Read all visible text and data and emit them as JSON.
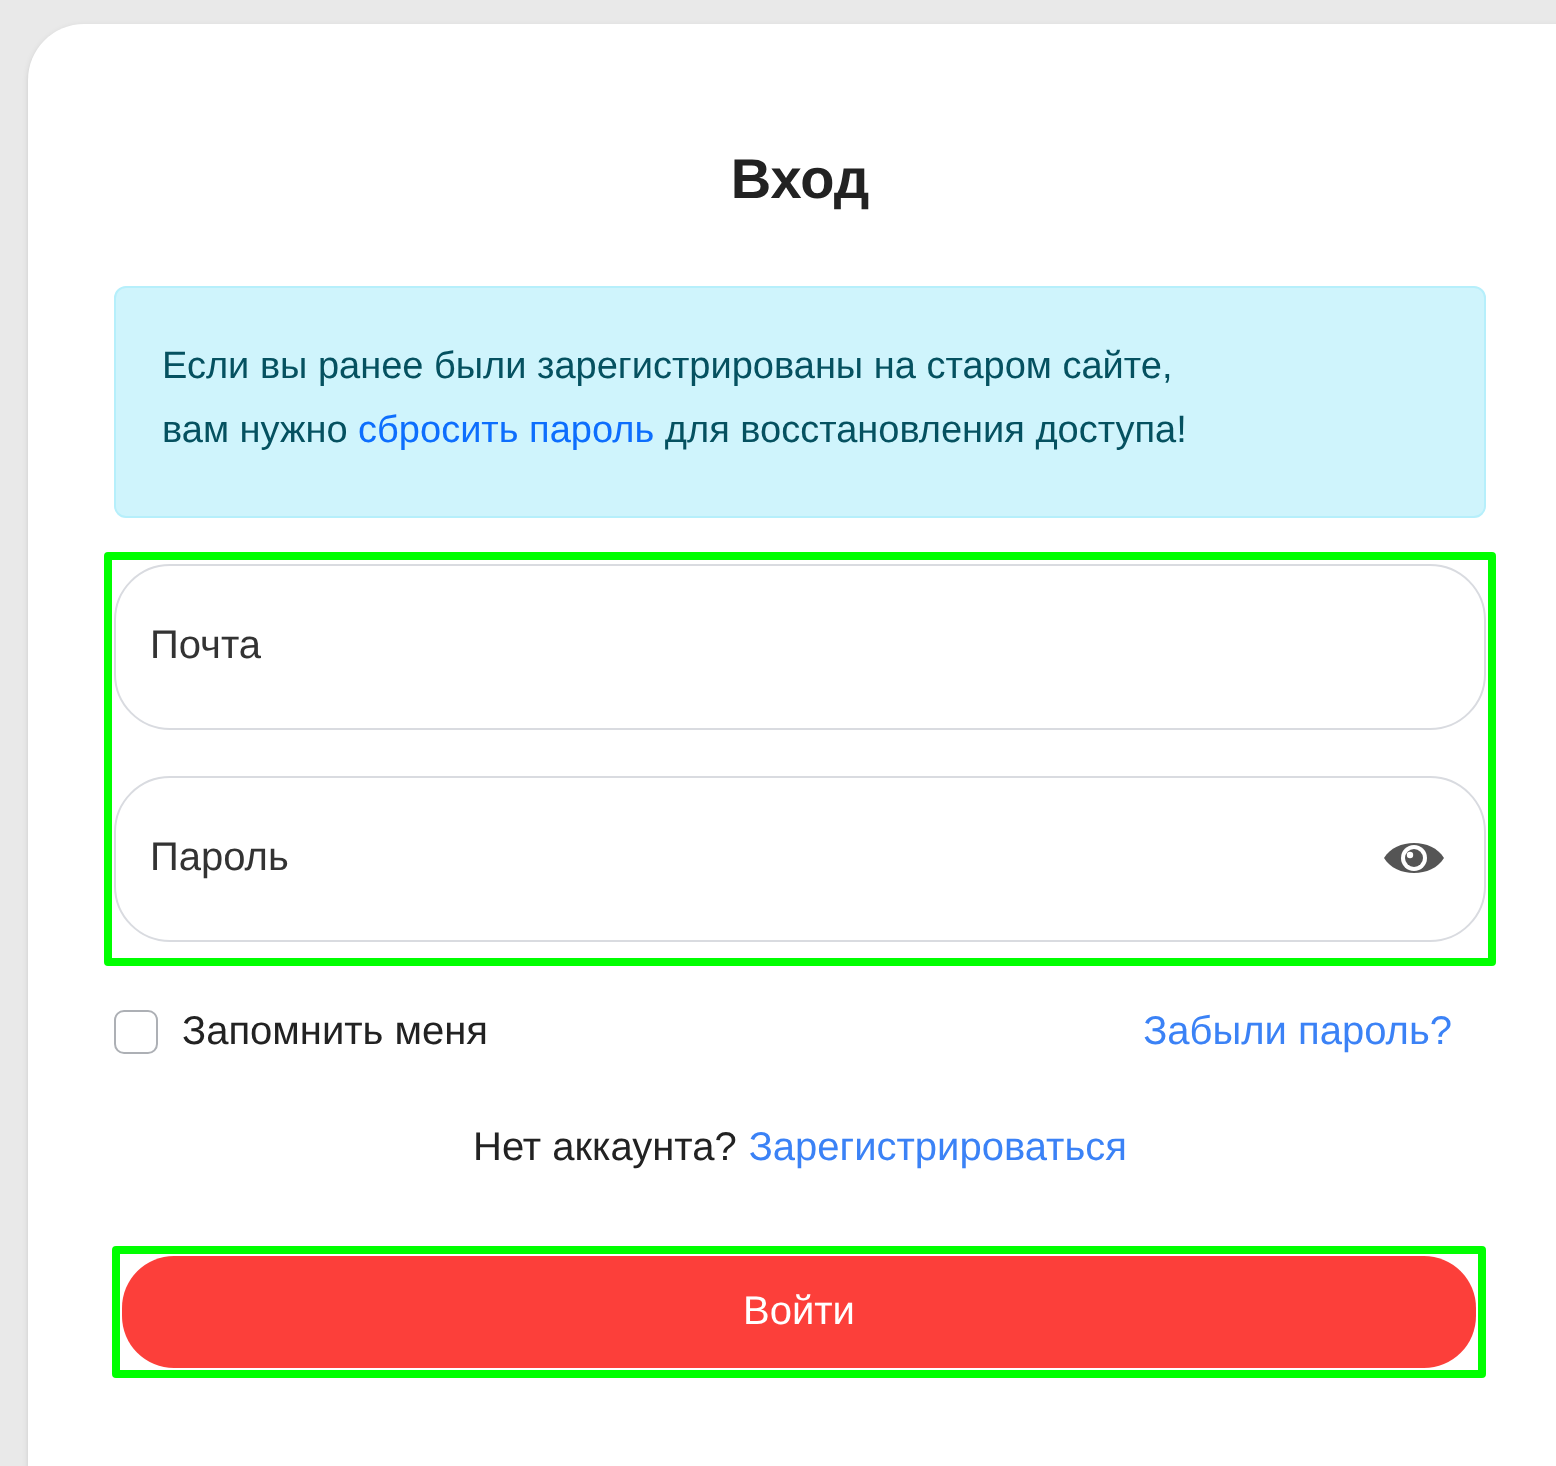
{
  "title": "Вход",
  "notice": {
    "text": "Если вы ранее были зарегистрированы на старом сайте, вам нужно",
    "link": "сбросить пароль",
    "after": "для восстановления доступа!"
  },
  "fields": [
    {
      "kind": "email",
      "placeholder": "Почта"
    },
    {
      "kind": "password",
      "placeholder": "Пароль"
    }
  ],
  "remember": {
    "label": "Запомнить меня",
    "checked": false
  },
  "forgot_link": "Забыли пароль?",
  "register": {
    "text": "Нет аккаунта?",
    "link": "Зарегистрироваться"
  },
  "submit": "Войти"
}
